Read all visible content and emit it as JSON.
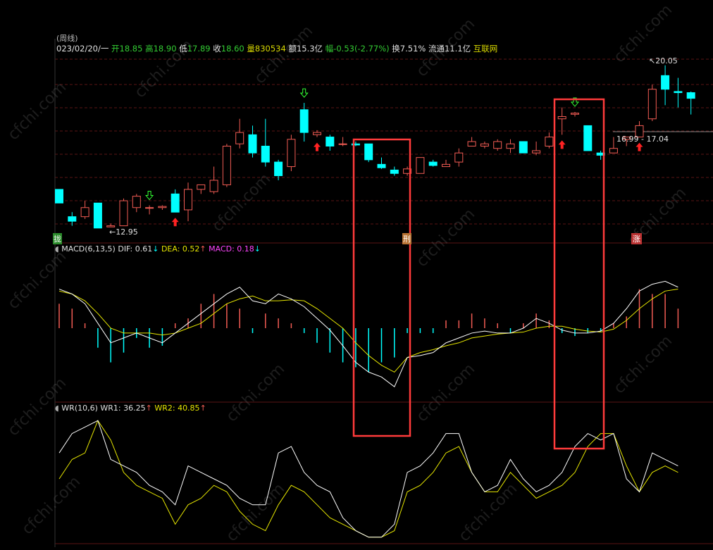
{
  "colors": {
    "up": "#f25c54",
    "down": "#00ffff",
    "dif": "#ffffff",
    "dea": "#e6e600",
    "macd_label": "#ff44ff",
    "wr1": "#ffffff",
    "wr2": "#e6e600",
    "grid": "#5a1414",
    "highlight": "#ff3b3b",
    "header_green": "#33cc33",
    "header_yellow": "#d8d800",
    "header_white": "#e0e0e0"
  },
  "header": {
    "title": "(周线)",
    "date": "023/02/20/一",
    "open_label": "开",
    "open_value": "18.85",
    "high_label": "高",
    "high_value": "18.90",
    "low_label": "低",
    "low_value": "17.89",
    "close_label": "收",
    "close_value": "18.60",
    "volume_label": "量",
    "volume_value": "830534",
    "amount_label": "额",
    "amount_value": "15.3亿",
    "change_label": "幅",
    "change_value": "-0.53(-2.77%)",
    "turnover_label": "换",
    "turnover_value": "7.51%",
    "float_label": "流通",
    "float_value": "11.1亿",
    "source": "互联网"
  },
  "annotations": {
    "high_price": "20.05",
    "low_price": "12.95",
    "range_label": "16.99 - 17.04",
    "left_badge": "拢",
    "mid_badge": "刑",
    "right_badge": "涨"
  },
  "macd_legend": {
    "name": "MACD(6,13,5)",
    "dif_label": "DIF: 0.61",
    "dif_arrow": "↓",
    "dea_label": "DEA: 0.52",
    "dea_arrow": "↑",
    "macd_label": "MACD: 0.18",
    "macd_arrow": "↓"
  },
  "wr_legend": {
    "name": "WR(10,6)",
    "wr1_label": "WR1: 36.25",
    "wr1_arrow": "↑",
    "wr2_label": "WR2: 40.85",
    "wr2_arrow": "↑"
  },
  "watermark": "cfchi.com",
  "chart_data": {
    "type": "candlestick",
    "price_range": [
      12.4,
      20.6
    ],
    "candles": [
      {
        "o": 14.6,
        "h": 14.6,
        "l": 14.0,
        "c": 14.0
      },
      {
        "o": 13.4,
        "h": 13.6,
        "l": 13.0,
        "c": 13.2
      },
      {
        "o": 13.4,
        "h": 14.1,
        "l": 13.3,
        "c": 13.8
      },
      {
        "o": 14.0,
        "h": 14.0,
        "l": 12.9,
        "c": 12.9
      },
      {
        "o": 12.95,
        "h": 13.1,
        "l": 12.95,
        "c": 13.0
      },
      {
        "o": 13.0,
        "h": 14.2,
        "l": 13.0,
        "c": 14.1
      },
      {
        "o": 13.8,
        "h": 14.4,
        "l": 13.6,
        "c": 14.3
      },
      {
        "o": 13.8,
        "h": 13.9,
        "l": 13.5,
        "c": 13.8
      },
      {
        "o": 13.8,
        "h": 13.9,
        "l": 13.7,
        "c": 13.85
      },
      {
        "o": 14.4,
        "h": 14.6,
        "l": 13.6,
        "c": 13.6
      },
      {
        "o": 13.7,
        "h": 14.9,
        "l": 13.2,
        "c": 14.6
      },
      {
        "o": 14.6,
        "h": 14.8,
        "l": 14.4,
        "c": 14.8
      },
      {
        "o": 14.5,
        "h": 15.6,
        "l": 14.4,
        "c": 15.0
      },
      {
        "o": 14.8,
        "h": 16.6,
        "l": 14.7,
        "c": 16.5
      },
      {
        "o": 16.6,
        "h": 17.7,
        "l": 16.4,
        "c": 17.1
      },
      {
        "o": 17.0,
        "h": 17.4,
        "l": 16.0,
        "c": 16.2
      },
      {
        "o": 16.5,
        "h": 17.7,
        "l": 15.6,
        "c": 15.8
      },
      {
        "o": 15.8,
        "h": 15.9,
        "l": 15.0,
        "c": 15.2
      },
      {
        "o": 15.6,
        "h": 17.0,
        "l": 15.4,
        "c": 16.8
      },
      {
        "o": 18.1,
        "h": 18.4,
        "l": 16.7,
        "c": 17.1
      },
      {
        "o": 17.0,
        "h": 17.2,
        "l": 16.9,
        "c": 17.1
      },
      {
        "o": 16.9,
        "h": 17.0,
        "l": 16.3,
        "c": 16.5
      },
      {
        "o": 16.6,
        "h": 16.9,
        "l": 16.5,
        "c": 16.6
      },
      {
        "o": 16.6,
        "h": 16.7,
        "l": 16.5,
        "c": 16.55
      },
      {
        "o": 16.6,
        "h": 16.6,
        "l": 15.8,
        "c": 15.9
      },
      {
        "o": 15.7,
        "h": 16.0,
        "l": 15.5,
        "c": 15.55
      },
      {
        "o": 15.45,
        "h": 15.6,
        "l": 15.2,
        "c": 15.3
      },
      {
        "o": 15.3,
        "h": 15.6,
        "l": 15.2,
        "c": 15.5
      },
      {
        "o": 15.3,
        "h": 16.0,
        "l": 15.3,
        "c": 16.0
      },
      {
        "o": 15.8,
        "h": 15.9,
        "l": 15.6,
        "c": 15.65
      },
      {
        "o": 15.6,
        "h": 15.9,
        "l": 15.6,
        "c": 15.7
      },
      {
        "o": 15.8,
        "h": 16.4,
        "l": 15.6,
        "c": 16.2
      },
      {
        "o": 16.5,
        "h": 16.9,
        "l": 16.5,
        "c": 16.7
      },
      {
        "o": 16.5,
        "h": 16.7,
        "l": 16.4,
        "c": 16.6
      },
      {
        "o": 16.4,
        "h": 16.8,
        "l": 16.3,
        "c": 16.7
      },
      {
        "o": 16.4,
        "h": 16.8,
        "l": 16.2,
        "c": 16.6
      },
      {
        "o": 16.7,
        "h": 16.7,
        "l": 16.2,
        "c": 16.2
      },
      {
        "o": 16.2,
        "h": 16.7,
        "l": 16.1,
        "c": 16.3
      },
      {
        "o": 16.5,
        "h": 17.1,
        "l": 16.4,
        "c": 16.9
      },
      {
        "o": 17.7,
        "h": 18.2,
        "l": 17.0,
        "c": 17.8
      },
      {
        "o": 17.9,
        "h": 18.0,
        "l": 17.8,
        "c": 17.95
      },
      {
        "o": 17.4,
        "h": 17.4,
        "l": 16.3,
        "c": 16.3
      },
      {
        "o": 16.2,
        "h": 16.3,
        "l": 15.9,
        "c": 16.1
      },
      {
        "o": 16.2,
        "h": 16.9,
        "l": 16.2,
        "c": 16.4
      },
      {
        "o": 16.8,
        "h": 16.9,
        "l": 16.5,
        "c": 16.9
      },
      {
        "o": 16.9,
        "h": 17.6,
        "l": 16.9,
        "c": 17.4
      },
      {
        "o": 17.7,
        "h": 19.2,
        "l": 17.6,
        "c": 19.0
      },
      {
        "o": 19.6,
        "h": 20.05,
        "l": 18.3,
        "c": 19.0
      },
      {
        "o": 18.9,
        "h": 19.5,
        "l": 18.2,
        "c": 18.85
      },
      {
        "o": 18.85,
        "h": 18.9,
        "l": 17.89,
        "c": 18.6
      }
    ],
    "signals_buy": [
      9,
      20,
      39,
      45
    ],
    "signals_sell": [
      7,
      19,
      40
    ],
    "macd": {
      "range": [
        -0.75,
        0.75
      ],
      "dif": [
        0.4,
        0.35,
        0.25,
        0.05,
        -0.15,
        -0.1,
        -0.05,
        -0.1,
        -0.15,
        -0.05,
        0.05,
        0.15,
        0.25,
        0.35,
        0.42,
        0.28,
        0.25,
        0.35,
        0.3,
        0.22,
        0.1,
        -0.02,
        -0.18,
        -0.35,
        -0.45,
        -0.5,
        -0.6,
        -0.3,
        -0.28,
        -0.25,
        -0.15,
        -0.1,
        -0.05,
        -0.03,
        -0.05,
        -0.05,
        0.0,
        0.1,
        0.05,
        -0.02,
        -0.05,
        -0.05,
        -0.03,
        0.05,
        0.2,
        0.38,
        0.45,
        0.48,
        0.42
      ],
      "dea": [
        0.38,
        0.35,
        0.28,
        0.15,
        0.0,
        -0.05,
        -0.05,
        -0.05,
        -0.07,
        -0.05,
        0.0,
        0.05,
        0.15,
        0.25,
        0.3,
        0.33,
        0.28,
        0.28,
        0.29,
        0.28,
        0.2,
        0.1,
        0.0,
        -0.15,
        -0.28,
        -0.38,
        -0.45,
        -0.3,
        -0.25,
        -0.22,
        -0.18,
        -0.15,
        -0.1,
        -0.08,
        -0.06,
        -0.05,
        -0.04,
        0.0,
        0.02,
        0.02,
        -0.01,
        -0.03,
        -0.04,
        -0.01,
        0.08,
        0.2,
        0.3,
        0.38,
        0.4
      ],
      "hist": [
        0.25,
        0.2,
        0.05,
        -0.2,
        -0.35,
        -0.25,
        -0.1,
        -0.2,
        -0.18,
        0.05,
        0.1,
        0.25,
        0.35,
        0.25,
        0.2,
        -0.05,
        0.15,
        0.1,
        0.05,
        -0.05,
        -0.15,
        -0.25,
        -0.35,
        -0.4,
        -0.45,
        -0.35,
        -0.3,
        -0.05,
        -0.05,
        -0.05,
        0.08,
        0.08,
        0.15,
        0.1,
        0.05,
        -0.05,
        0.05,
        0.15,
        0.08,
        -0.05,
        -0.08,
        -0.05,
        -0.03,
        0.05,
        0.12,
        0.4,
        0.35,
        0.35,
        0.2
      ]
    },
    "wr": {
      "range": [
        0,
        100
      ],
      "wr1": [
        70,
        85,
        90,
        95,
        65,
        60,
        55,
        45,
        40,
        30,
        60,
        55,
        50,
        45,
        35,
        30,
        30,
        70,
        75,
        55,
        45,
        40,
        20,
        10,
        5,
        5,
        15,
        55,
        60,
        70,
        85,
        85,
        55,
        40,
        45,
        65,
        50,
        40,
        45,
        55,
        75,
        85,
        80,
        85,
        50,
        40,
        70,
        65,
        60
      ],
      "wr2": [
        50,
        65,
        70,
        95,
        80,
        55,
        45,
        40,
        35,
        15,
        30,
        35,
        45,
        40,
        25,
        15,
        10,
        30,
        45,
        40,
        30,
        20,
        15,
        10,
        5,
        5,
        10,
        40,
        45,
        55,
        70,
        75,
        55,
        40,
        40,
        55,
        45,
        35,
        40,
        45,
        55,
        75,
        85,
        85,
        60,
        40,
        55,
        60,
        55
      ]
    }
  }
}
